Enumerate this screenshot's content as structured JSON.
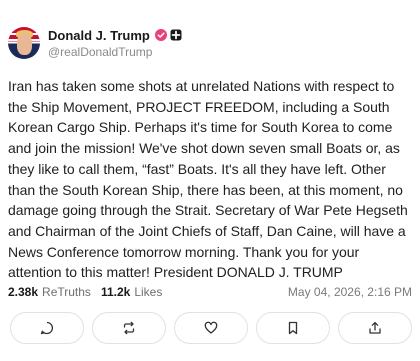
{
  "post": {
    "author_name": "Donald J. Trump",
    "handle": "@realDonaldTrump",
    "text": "Iran has taken some shots at unrelated Nations with respect to the Ship Movement, PROJECT FREEDOM, including a South Korean Cargo Ship. Perhaps it's time for South Korea to come and join the mission! We've shot down seven small Boats or, as they like to call them, “fast” Boats. It's all they have left. Other than the South Korean Ship, there has been, at this moment, no damage going through the Strait. Secretary of War Pete Hegseth and Chairman of the Joint Chiefs of Staff, Dan Caine, will have a News Conference tomorrow morning. Thank you for your attention to this matter! President DONALD J. TRUMP",
    "retruths_count": "2.38k",
    "retruths_label": "ReTruths",
    "likes_count": "11.2k",
    "likes_label": "Likes",
    "date": "May 04, 2026, 2:16 PM"
  },
  "icons": {
    "verified": "verified-badge-icon",
    "shield": "shield-icon",
    "reply": "reply-icon",
    "retruth": "retruth-icon",
    "like": "heart-icon",
    "bookmark": "bookmark-icon",
    "share": "share-icon"
  },
  "colors": {
    "verified": "#e9417b",
    "text": "#1f1f1f",
    "muted": "#7a7a7a"
  }
}
